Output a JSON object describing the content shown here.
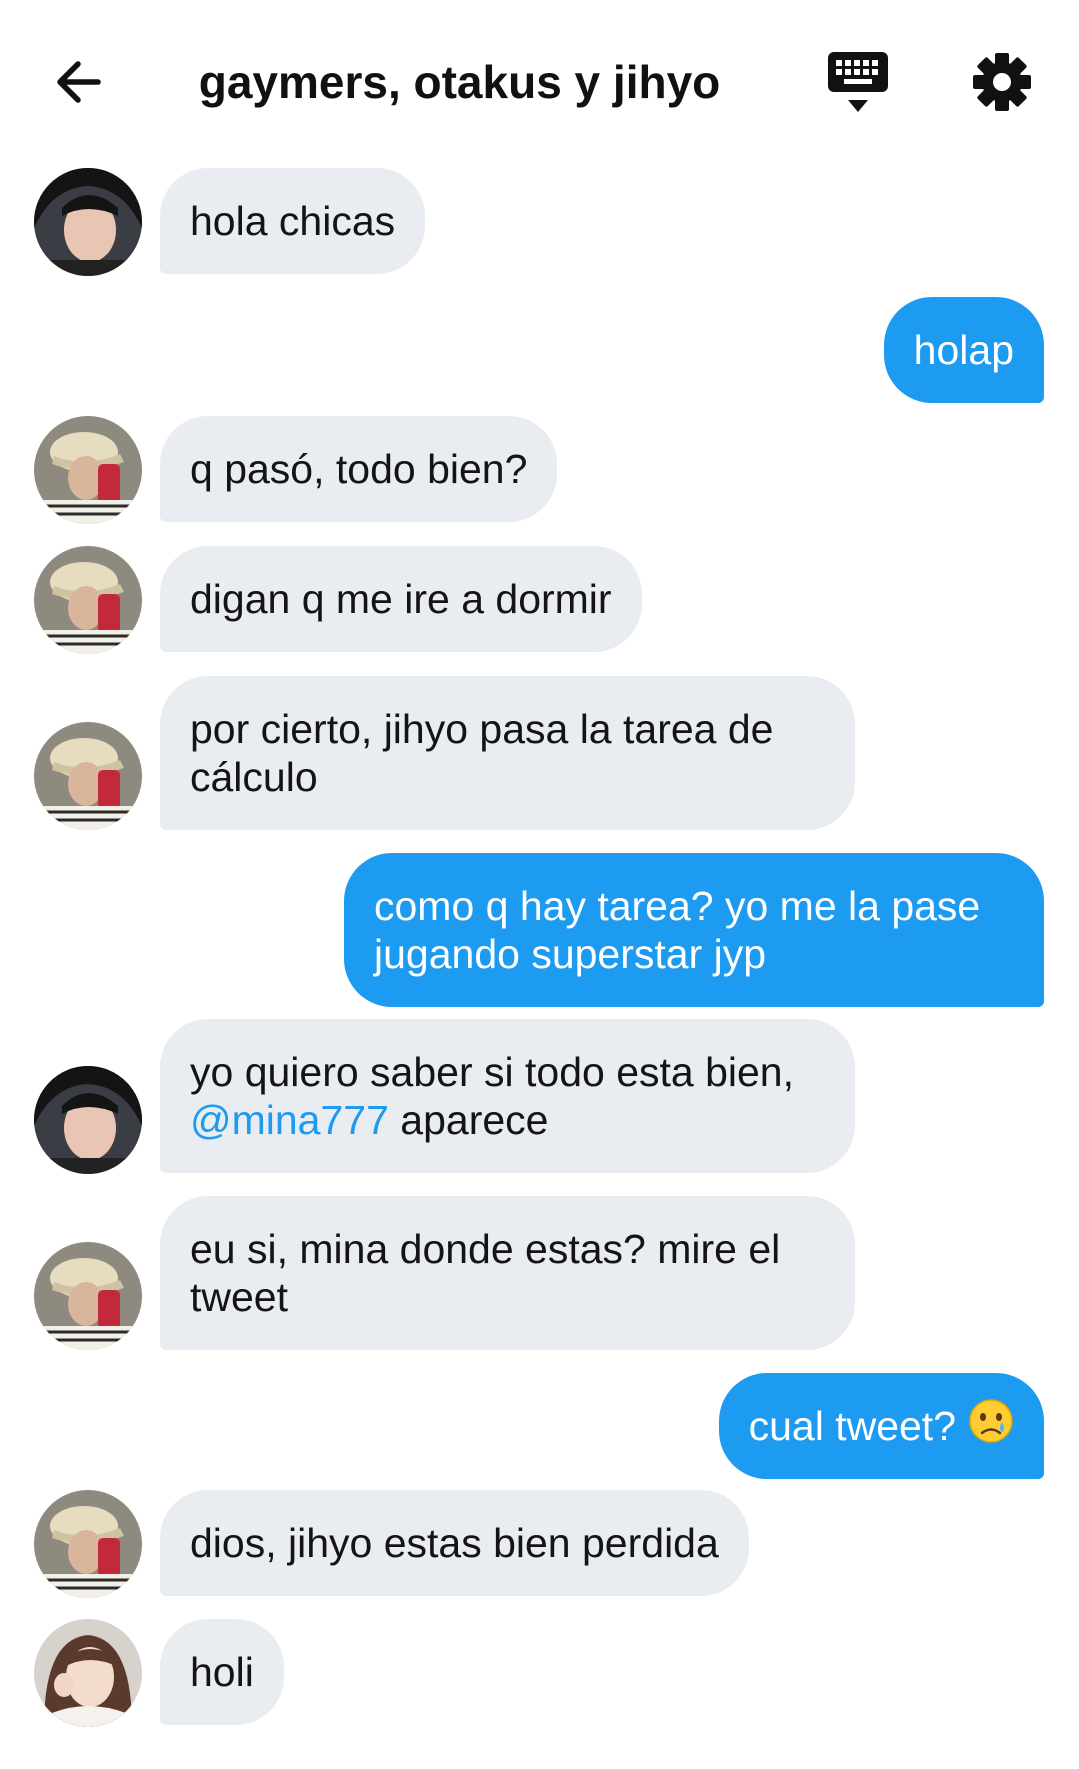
{
  "header": {
    "title": "gaymers, otakus y jihyo",
    "icons": [
      "back-arrow-icon",
      "keyboard-icon",
      "gear-icon"
    ]
  },
  "messages": [
    {
      "side": "in",
      "avatar": "avatar-a",
      "text": "hola chicas"
    },
    {
      "side": "out",
      "text": "holap"
    },
    {
      "side": "in",
      "avatar": "avatar-b",
      "text": "q pasó, todo bien?"
    },
    {
      "side": "in",
      "avatar": "avatar-b",
      "text": "digan q me ire a dormir"
    },
    {
      "side": "in",
      "avatar": "avatar-b",
      "line1": "por cierto, jihyo pasa la tarea de",
      "line2": "cálculo"
    },
    {
      "side": "out",
      "line1": "como q hay tarea? yo me la pase",
      "line2": "jugando superstar jyp"
    },
    {
      "side": "in",
      "avatar": "avatar-a",
      "line1": "yo quiero saber si todo esta bien,",
      "mention": "@mina777",
      "line2_rest": " aparece"
    },
    {
      "side": "in",
      "avatar": "avatar-b",
      "line1": "eu si, mina donde estas? mire el",
      "line2": "tweet"
    },
    {
      "side": "out",
      "text": "cual tweet?",
      "emoji": "crying-face-emoji"
    },
    {
      "side": "in",
      "avatar": "avatar-b",
      "text": "dios, jihyo estas bien perdida"
    },
    {
      "side": "in",
      "avatar": "avatar-c",
      "text": "holi"
    }
  ],
  "colors": {
    "outgoing_bubble": "#1d9bf0",
    "incoming_bubble": "#e9ecf0",
    "mention": "#1d9bf0",
    "background": "#ffffff"
  }
}
